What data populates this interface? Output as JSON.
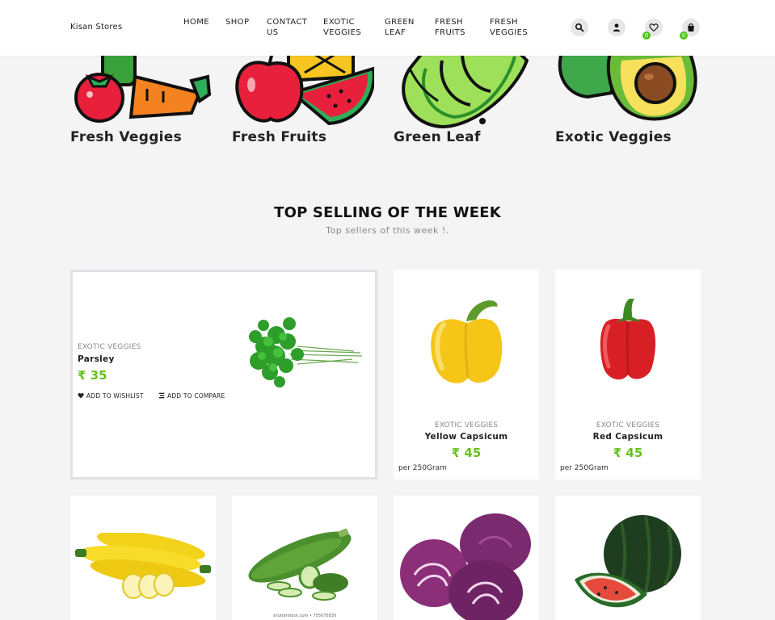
{
  "brand": "Kisan Stores",
  "nav": [
    {
      "label": "HOME"
    },
    {
      "label": "SHOP"
    },
    {
      "label": "CONTACT US"
    },
    {
      "label": "EXOTIC VEGGIES"
    },
    {
      "label": "GREEN LEAF"
    },
    {
      "label": "FRESH FRUITS"
    },
    {
      "label": "FRESH VEGGIES"
    }
  ],
  "header_icons": {
    "wishlist_count": "0",
    "cart_count": "0"
  },
  "categories": [
    {
      "label": "Fresh Veggies",
      "icon": "veggies-illustration"
    },
    {
      "label": "Fresh Fruits",
      "icon": "fruits-illustration"
    },
    {
      "label": "Green Leaf",
      "icon": "lettuce-illustration"
    },
    {
      "label": "Exotic Veggies",
      "icon": "avocado-illustration"
    }
  ],
  "section": {
    "title": "TOP SELLING OF THE WEEK",
    "subtitle": "Top sellers of this week !."
  },
  "featured": {
    "category": "EXOTIC VEGGIES",
    "name": "Parsley",
    "price": "₹ 35",
    "wishlist_label": "ADD TO WISHLIST",
    "compare_label": "ADD TO COMPARE"
  },
  "products": [
    {
      "category": "EXOTIC VEGGIES",
      "name": "Yellow Capsicum",
      "price": "₹ 45",
      "unit": "per 250Gram"
    },
    {
      "category": "EXOTIC VEGGIES",
      "name": "Red Capsicum",
      "price": "₹ 45",
      "unit": "per 250Gram"
    }
  ],
  "bottom_products": [
    {
      "image": "yellow-zucchini-image"
    },
    {
      "image": "green-zucchini-image",
      "caption": "shutterstock.com • 755075830"
    },
    {
      "image": "red-cabbage-image"
    },
    {
      "image": "watermelon-image"
    }
  ],
  "colors": {
    "accent_green": "#66c21a",
    "badge_green": "#4fc51b",
    "page_bg": "#f4f4f4"
  }
}
